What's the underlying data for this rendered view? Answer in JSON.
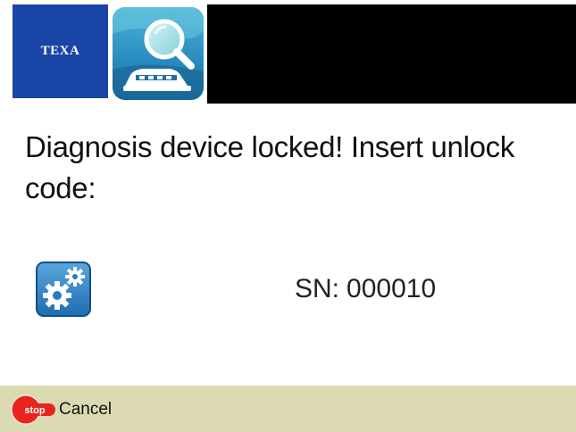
{
  "header": {
    "logo_text": "TEXA",
    "app_icon": "vehicle-search-icon"
  },
  "message": {
    "text": "Diagnosis device locked! Insert unlock code:"
  },
  "device": {
    "settings_icon": "gears-icon",
    "sn_label": "SN:",
    "sn_value": "000010"
  },
  "footer": {
    "stop_icon_text": "stop",
    "cancel_label": "Cancel"
  },
  "colors": {
    "logo_blue": "#1945a6",
    "header_black": "#000000",
    "footer_bg": "#dbdab3",
    "stop_red": "#e8251d",
    "icon_blue": "#2a7fb8"
  }
}
